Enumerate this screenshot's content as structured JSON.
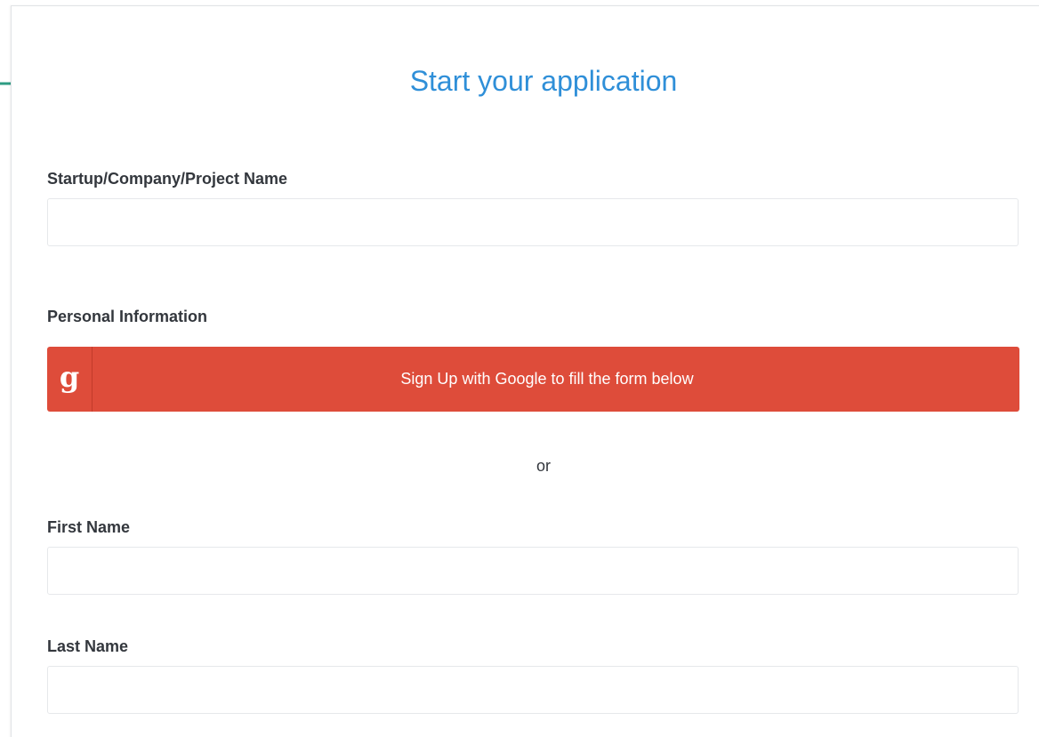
{
  "form": {
    "title": "Start your application",
    "company_label": "Startup/Company/Project Name",
    "company_value": "",
    "personal_info_label": "Personal Information",
    "google_button_label": "Sign Up with Google to fill the form below",
    "google_icon_glyph": "g",
    "or_text": "or",
    "first_name_label": "First Name",
    "first_name_value": "",
    "last_name_label": "Last Name",
    "last_name_value": ""
  },
  "colors": {
    "title": "#2f8fd8",
    "google_button": "#de4c3a",
    "arrow": "#2e9c83"
  },
  "icons": {
    "annotation_arrow": "arrow-right-icon",
    "google": "google-icon"
  }
}
